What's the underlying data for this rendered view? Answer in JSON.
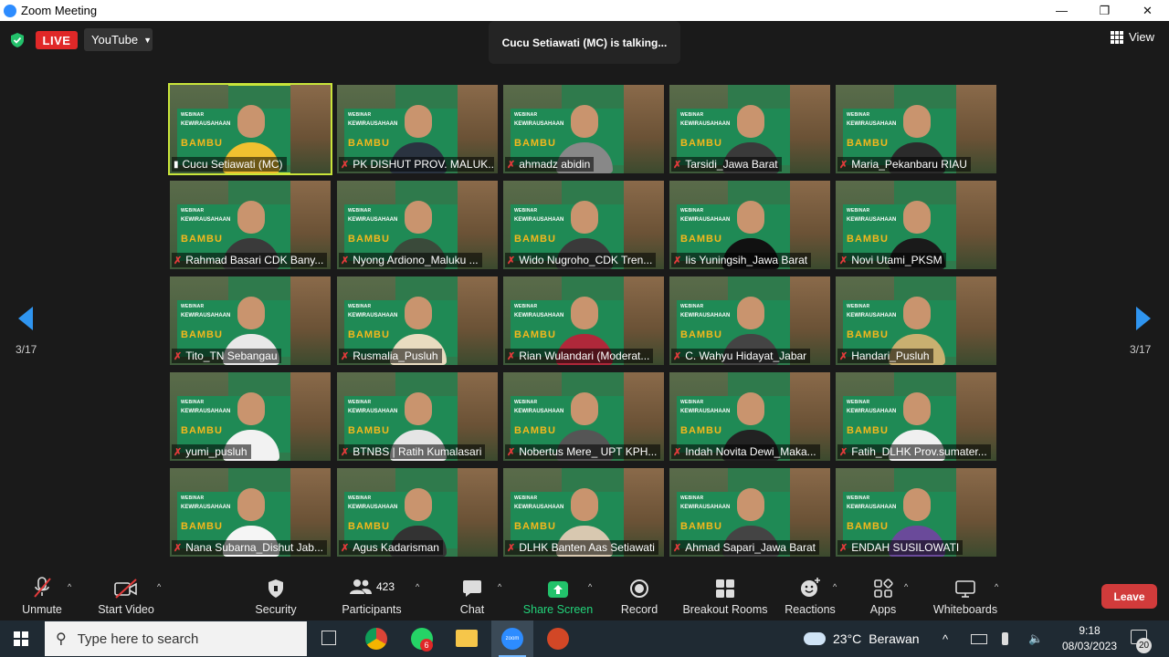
{
  "window": {
    "title": "Zoom Meeting",
    "minimize": "—",
    "maximize": "❐",
    "close": "✕"
  },
  "top": {
    "live_label": "LIVE",
    "stream_platform": "YouTube",
    "talking": "Cucu Setiawati (MC) is talking...",
    "view_label": "View",
    "page_left": "3/17",
    "page_right": "3/17"
  },
  "banner": {
    "small": "WEBINAR",
    "mid": "KEWIRAUSAHAAN",
    "big": "BAMBU"
  },
  "participants": [
    {
      "name": "Cucu Setiawati (MC)",
      "speaking": true,
      "shirt": "#f0c030"
    },
    {
      "name": "PK DISHUT PROV. MALUK...",
      "speaking": false,
      "shirt": "#2a3340"
    },
    {
      "name": "ahmadz abidin",
      "speaking": false,
      "shirt": "#888"
    },
    {
      "name": "Tarsidi_Jawa Barat",
      "speaking": false,
      "shirt": "#3a3a3a"
    },
    {
      "name": "Maria_Pekanbaru RIAU",
      "speaking": false,
      "shirt": "#2b2b2b"
    },
    {
      "name": "Rahmad Basari CDK Bany...",
      "speaking": false,
      "shirt": "#3a3a3a"
    },
    {
      "name": "Nyong Ardiono_Maluku ...",
      "speaking": false,
      "shirt": "#3a4a3a"
    },
    {
      "name": "Wido Nugroho_CDK Tren...",
      "speaking": false,
      "shirt": "#3a3a3a"
    },
    {
      "name": "Iis Yuningsih_Jawa Barat",
      "speaking": false,
      "shirt": "#111"
    },
    {
      "name": "Novi Utami_PKSM",
      "speaking": false,
      "shirt": "#1a1a1a"
    },
    {
      "name": "Tito_TN Sebangau",
      "speaking": false,
      "shirt": "#e8e8e8"
    },
    {
      "name": "Rusmalia_Pusluh",
      "speaking": false,
      "shirt": "#e9dcc0"
    },
    {
      "name": "Rian Wulandari (Moderat...",
      "speaking": false,
      "shirt": "#b0283a"
    },
    {
      "name": "C. Wahyu Hidayat_Jabar",
      "speaking": false,
      "shirt": "#444"
    },
    {
      "name": "Handari_Pusluh",
      "speaking": false,
      "shirt": "#c9b070"
    },
    {
      "name": "yumi_pusluh",
      "speaking": false,
      "shirt": "#f2f2f2"
    },
    {
      "name": "BTNBS | Ratih Kumalasari",
      "speaking": false,
      "shirt": "#e5e5e5"
    },
    {
      "name": "Nobertus Mere_ UPT KPH...",
      "speaking": false,
      "shirt": "#555"
    },
    {
      "name": "Indah Novita Dewi_Maka...",
      "speaking": false,
      "shirt": "#222"
    },
    {
      "name": "Fatih_DLHK Prov.sumater...",
      "speaking": false,
      "shirt": "#f0f0f0"
    },
    {
      "name": "Nana Subarna_Dishut Jab...",
      "speaking": false,
      "shirt": "#f5f5f5"
    },
    {
      "name": "Agus Kadarisman",
      "speaking": false,
      "shirt": "#333"
    },
    {
      "name": "DLHK Banten Aas Setiawati",
      "speaking": false,
      "shirt": "#d8c8b0"
    },
    {
      "name": "Ahmad Sapari_Jawa Barat",
      "speaking": false,
      "shirt": "#444"
    },
    {
      "name": "ENDAH SUSILOWATI",
      "speaking": false,
      "shirt": "#6a4a9a"
    }
  ],
  "toolbar": {
    "unmute": "Unmute",
    "start_video": "Start Video",
    "security": "Security",
    "participants": "Participants",
    "participant_count": "423",
    "chat": "Chat",
    "share_screen": "Share Screen",
    "record": "Record",
    "breakout": "Breakout Rooms",
    "reactions": "Reactions",
    "apps": "Apps",
    "whiteboards": "Whiteboards",
    "leave": "Leave"
  },
  "taskbar": {
    "search_placeholder": "Type here to search",
    "whatsapp_badge": "6",
    "zoom_label": "zoom",
    "temperature": "23°C",
    "weather": "Berawan",
    "time": "9:18",
    "date": "08/03/2023",
    "notifications": "20"
  }
}
